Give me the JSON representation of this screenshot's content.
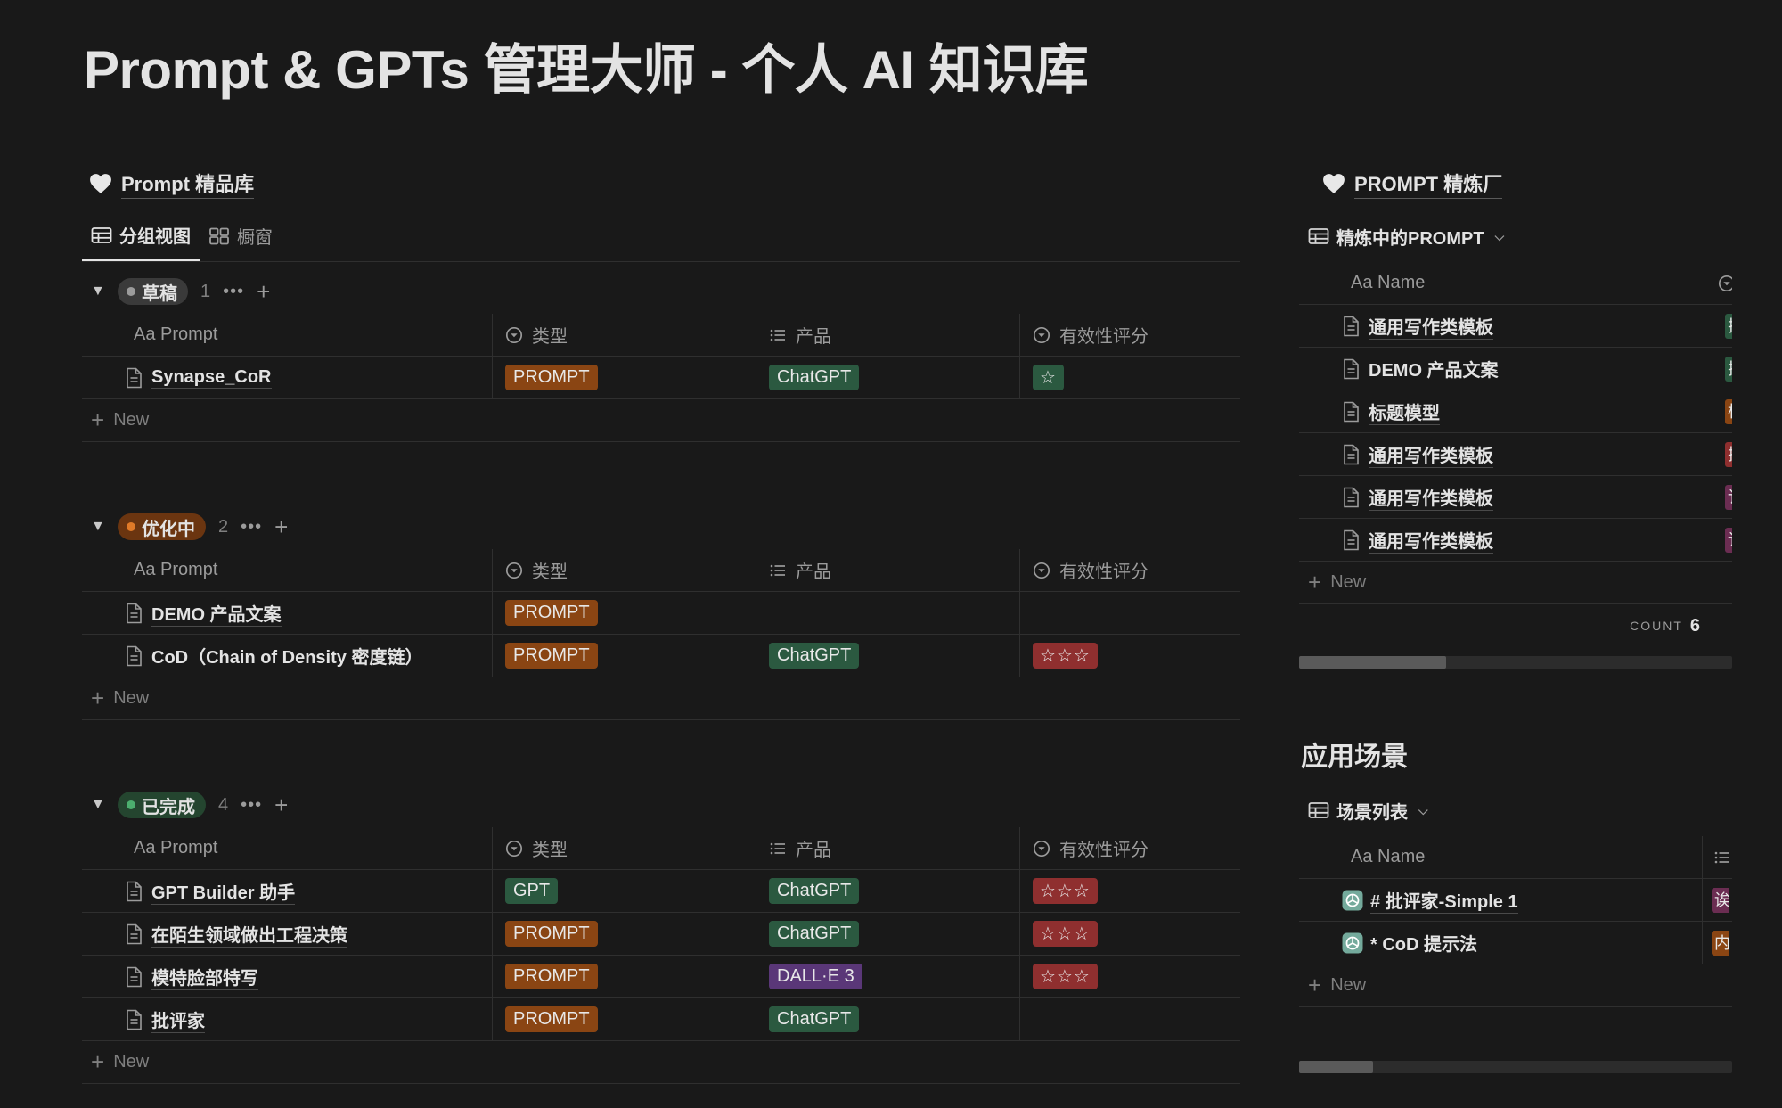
{
  "page": {
    "title": "Prompt & GPTs 管理大师 - 个人 AI 知识库"
  },
  "left": {
    "title": "Prompt 精品库",
    "views": [
      {
        "label": "分组视图",
        "active": true
      },
      {
        "label": "橱窗",
        "active": false
      }
    ],
    "headers": {
      "name": "Aa Prompt",
      "type": "类型",
      "product": "产品",
      "score": "有效性评分"
    },
    "new_label": "New",
    "groups": [
      {
        "status": "草稿",
        "count": "1",
        "pill_bg": "#3a3a3a",
        "dot": "#9b9b9b",
        "rows": [
          {
            "name": "Synapse_CoR",
            "type": "PROMPT",
            "type_color": "orange",
            "product": "ChatGPT",
            "product_color": "green",
            "score": "☆",
            "score_color": "olive"
          }
        ]
      },
      {
        "status": "优化中",
        "count": "2",
        "pill_bg": "#6b3510",
        "dot": "#e07a28",
        "rows": [
          {
            "name": "DEMO 产品文案",
            "type": "PROMPT",
            "type_color": "orange",
            "product": "",
            "product_color": "",
            "score": "",
            "score_color": ""
          },
          {
            "name": "CoD（Chain of Density 密度链）",
            "type": "PROMPT",
            "type_color": "orange",
            "product": "ChatGPT",
            "product_color": "green",
            "score": "☆☆☆",
            "score_color": "red"
          }
        ]
      },
      {
        "status": "已完成",
        "count": "4",
        "pill_bg": "#24452f",
        "dot": "#4cae6e",
        "rows": [
          {
            "name": "GPT Builder 助手",
            "type": "GPT",
            "type_color": "green",
            "product": "ChatGPT",
            "product_color": "green",
            "score": "☆☆☆",
            "score_color": "red"
          },
          {
            "name": "在陌生领域做出工程决策",
            "type": "PROMPT",
            "type_color": "orange",
            "product": "ChatGPT",
            "product_color": "green",
            "score": "☆☆☆",
            "score_color": "red"
          },
          {
            "name": "模特脸部特写",
            "type": "PROMPT",
            "type_color": "orange",
            "product": "DALL·E 3",
            "product_color": "purple",
            "score": "☆☆☆",
            "score_color": "red"
          },
          {
            "name": "批评家",
            "type": "PROMPT",
            "type_color": "orange",
            "product": "ChatGPT",
            "product_color": "green",
            "score": "",
            "score_color": ""
          }
        ]
      }
    ]
  },
  "refinery": {
    "title": "PROMPT 精炼厂",
    "view": "精炼中的PROMPT",
    "header_name": "Aa Name",
    "rows": [
      {
        "name": "通用写作类模板",
        "sliver_color": "#2b5940",
        "sliver_text": "拉"
      },
      {
        "name": "DEMO 产品文案",
        "sliver_color": "#2b5940",
        "sliver_text": "拉"
      },
      {
        "name": "标题模型",
        "sliver_color": "#8a4513",
        "sliver_text": "标"
      },
      {
        "name": "通用写作类模板",
        "sliver_color": "#8f2f2f",
        "sliver_text": "拉"
      },
      {
        "name": "通用写作类模板",
        "sliver_color": "#6b2d52",
        "sliver_text": "讠"
      },
      {
        "name": "通用写作类模板",
        "sliver_color": "#6b2d52",
        "sliver_text": "讠"
      }
    ],
    "new_label": "New",
    "count_label": "COUNT",
    "count_value": "6",
    "scroll_fraction": 0.34
  },
  "scenes": {
    "title": "应用场景",
    "view": "场景列表",
    "header_name": "Aa Name",
    "rows": [
      {
        "name": "# 批评家-Simple 1",
        "sliver_color": "#6b2d52",
        "sliver_text": "诶"
      },
      {
        "name": "* CoD 提示法",
        "sliver_color": "#8a4513",
        "sliver_text": "内"
      }
    ],
    "new_label": "New",
    "scroll_fraction": 0.17
  }
}
